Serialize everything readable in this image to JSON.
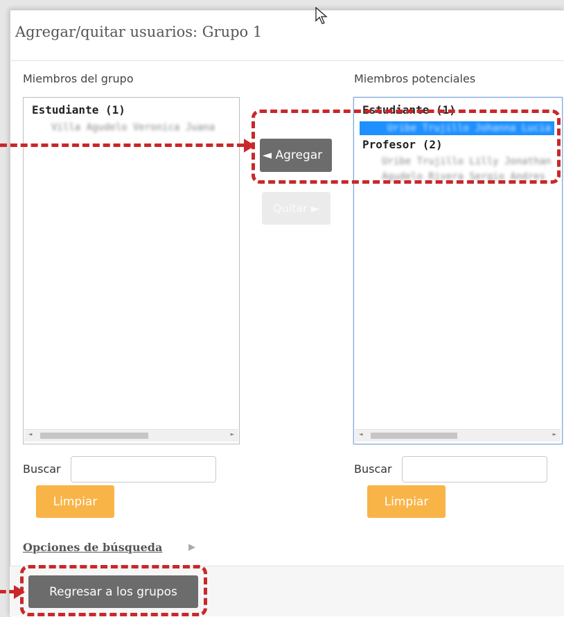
{
  "dialog": {
    "title": "Agregar/quitar usuarios: Grupo 1"
  },
  "members": {
    "label": "Miembros del grupo",
    "groups": [
      {
        "name": "Estudiante (1)",
        "users": [
          "Villa Agudelo Veronica Juana"
        ]
      }
    ]
  },
  "potential": {
    "label": "Miembros potenciales",
    "groups": [
      {
        "name": "Estudiante (1)",
        "users": [
          "Uribe Trujillo Johanna Lucia"
        ],
        "selected_index": 0
      },
      {
        "name": "Profesor (2)",
        "users": [
          "Uribe Trujillo Lilly Jonathan",
          "Agudelo Rivera Sergio Andres"
        ]
      }
    ]
  },
  "actions": {
    "add_label": "◄ Agregar",
    "remove_label": "Quitar ►"
  },
  "search": {
    "label": "Buscar",
    "value": "",
    "clear_label": "Limpiar"
  },
  "search_options_label": "Opciones de búsqueda",
  "back_label": "Regresar a los grupos",
  "colors": {
    "callout": "#c8282a",
    "primary_button": "#6c6c6c",
    "clear_button": "#f9b447",
    "selection": "#1e90ff"
  },
  "icons": {
    "collapse": "chevron-right-icon",
    "cursor": "mouse-pointer-icon"
  }
}
